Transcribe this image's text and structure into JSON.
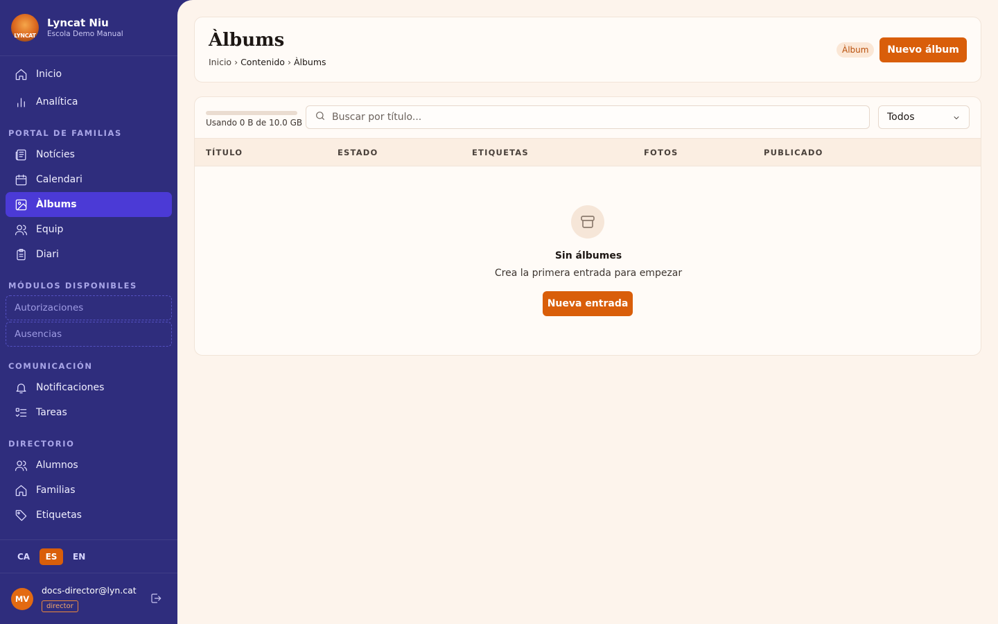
{
  "brand": {
    "name": "Lyncat Niu",
    "subtitle": "Escola Demo Manual",
    "logo_text": "LYNCAT"
  },
  "sidebar": {
    "top_items": [
      {
        "label": "Inicio",
        "icon": "home-icon"
      },
      {
        "label": "Analítica",
        "icon": "bar-chart-icon"
      }
    ],
    "sections": [
      {
        "title": "PORTAL DE FAMILIAS",
        "items": [
          {
            "label": "Notícies",
            "icon": "newspaper-icon"
          },
          {
            "label": "Calendari",
            "icon": "calendar-icon"
          },
          {
            "label": "Àlbums",
            "icon": "image-icon",
            "active": true
          },
          {
            "label": "Equip",
            "icon": "users-icon"
          },
          {
            "label": "Diari",
            "icon": "clipboard-icon"
          }
        ]
      },
      {
        "title": "MÓDULOS DISPONIBLES",
        "items": [
          {
            "label": "Autorizaciones"
          },
          {
            "label": "Ausencias"
          }
        ]
      },
      {
        "title": "COMUNICACIÓN",
        "items": [
          {
            "label": "Notificaciones",
            "icon": "bell-icon"
          },
          {
            "label": "Tareas",
            "icon": "checklist-icon"
          }
        ]
      },
      {
        "title": "DIRECTORIO",
        "items": [
          {
            "label": "Alumnos",
            "icon": "users-icon"
          },
          {
            "label": "Familias",
            "icon": "home-icon"
          },
          {
            "label": "Etiquetas",
            "icon": "tag-icon"
          }
        ]
      }
    ],
    "languages": [
      {
        "code": "CA",
        "active": false
      },
      {
        "code": "ES",
        "active": true
      },
      {
        "code": "EN",
        "active": false
      }
    ],
    "user": {
      "initials": "MV",
      "email": "docs-director@lyn.cat",
      "role": "director"
    }
  },
  "header": {
    "title": "Àlbums",
    "breadcrumb": [
      "Inicio",
      "Contenido",
      "Àlbums"
    ],
    "breadcrumb_sep": "›",
    "type_badge": "Àlbum",
    "new_button": "Nuevo álbum"
  },
  "toolbar": {
    "storage_text": "Usando 0 B de 10.0 GB",
    "storage_fraction": 0,
    "search_placeholder": "Buscar por título...",
    "filter_value": "Todos"
  },
  "table": {
    "columns": [
      "TÍTULO",
      "ESTADO",
      "ETIQUETAS",
      "FOTOS",
      "PUBLICADO"
    ],
    "rows": []
  },
  "empty_state": {
    "icon": "archive-icon",
    "title": "Sin álbumes",
    "subtitle": "Crea la primera entrada para empezar",
    "button": "Nueva entrada"
  },
  "colors": {
    "sidebar_bg": "#2f2d7d",
    "active_item": "#4b3ad6",
    "accent": "#d95e0a",
    "main_bg": "#fdf4ec"
  }
}
